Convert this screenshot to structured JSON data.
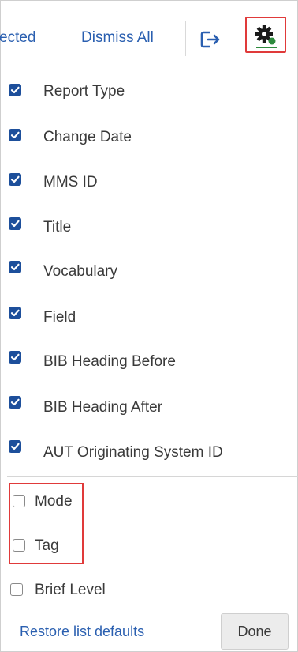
{
  "toolbar": {
    "selected_label": "ected",
    "dismiss_label": "Dismiss All",
    "export_icon": "export-icon",
    "settings_icon": "gear-icon"
  },
  "columns": {
    "checked": [
      "Report Type",
      "Change Date",
      "MMS ID",
      "Title",
      "Vocabulary",
      "Field",
      "BIB Heading Before",
      "BIB Heading After",
      "AUT Originating System ID"
    ],
    "unchecked": [
      "Mode",
      "Tag",
      "Brief Level"
    ]
  },
  "footer": {
    "restore_label": "Restore list defaults",
    "done_label": "Done"
  },
  "colors": {
    "link": "#2a5fb0",
    "checkbox": "#1d4f9b",
    "highlight": "#e03a3a",
    "gear_dot": "#2e8b3e"
  }
}
